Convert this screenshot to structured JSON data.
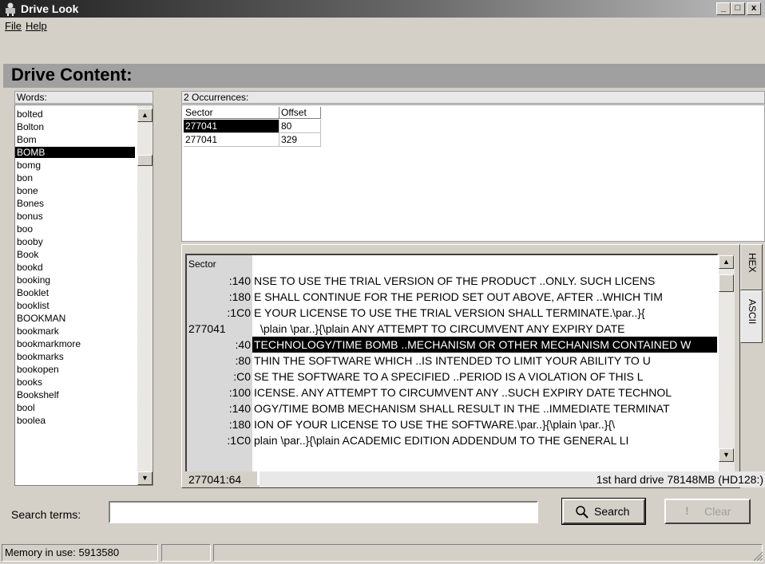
{
  "window": {
    "title": "Drive Look",
    "minimize": "_",
    "maximize": "□",
    "close": "x"
  },
  "menu": [
    {
      "label": "File"
    },
    {
      "label": "Help"
    }
  ],
  "heading": "Drive Content:",
  "words": {
    "label": "Words:",
    "items": [
      "bolted",
      "Bolton",
      "Bom",
      "BOMB",
      "bomg",
      "bon",
      "bone",
      "Bones",
      "bonus",
      "boo",
      "booby",
      "Book",
      "bookd",
      "booking",
      "Booklet",
      "booklist",
      "BOOKMAN",
      "bookmark",
      "bookmarkmore",
      "bookmarks",
      "bookopen",
      "books",
      "Bookshelf",
      "bool",
      "boolea"
    ],
    "selected": "BOMB"
  },
  "occurrences": {
    "label": "2 Occurrences:",
    "columns": [
      "Sector",
      "Offset"
    ],
    "rows": [
      [
        "277041",
        "80"
      ],
      [
        "277041",
        "329"
      ]
    ]
  },
  "viewer": {
    "header": "Sector",
    "sector": "277041",
    "lines": [
      {
        "offset": ":140",
        "text": "NSE TO USE THE TRIAL VERSION OF THE PRODUCT ..ONLY.  SUCH LICENS"
      },
      {
        "offset": ":180",
        "text": "E SHALL CONTINUE FOR THE PERIOD SET OUT ABOVE, AFTER ..WHICH TIM"
      },
      {
        "offset": ":1C0",
        "text": "E YOUR LICENSE TO USE THE TRIAL VERSION SHALL TERMINATE.\\par..}{"
      },
      {
        "offset": "",
        "text": "\\plain \\par..}{\\plain ANY ATTEMPT TO CIRCUMVENT ANY EXPIRY DATE"
      },
      {
        "offset": ":40",
        "text": "TECHNOLOGY/TIME BOMB ..MECHANISM OR OTHER MECHANISM CONTAINED W"
      },
      {
        "offset": ":80",
        "text": "THIN THE SOFTWARE WHICH ..IS INTENDED TO LIMIT YOUR ABILITY TO U"
      },
      {
        "offset": ":C0",
        "text": "SE THE SOFTWARE TO A SPECIFIED ..PERIOD IS A VIOLATION OF THIS L"
      },
      {
        "offset": ":100",
        "text": "ICENSE. ANY ATTEMPT TO CIRCUMVENT ANY ..SUCH EXPIRY DATE TECHNOL"
      },
      {
        "offset": ":140",
        "text": "OGY/TIME BOMB MECHANISM SHALL RESULT IN THE ..IMMEDIATE TERMINAT"
      },
      {
        "offset": ":180",
        "text": "ION OF YOUR LICENSE TO USE THE SOFTWARE.\\par..}{\\plain \\par..}{\\"
      },
      {
        "offset": ":1C0",
        "text": "plain \\par..}{\\plain ACADEMIC EDITION ADDENDUM TO THE GENERAL LI"
      }
    ],
    "tabs": [
      "HEX",
      "ASCII"
    ],
    "position": "277041:64",
    "drive": "1st hard drive 78148MB (HD128:)"
  },
  "search": {
    "label": "Search terms:",
    "value": "",
    "search_label": "Search",
    "clear_label": "Clear"
  },
  "status": {
    "memory": "Memory in use: 5913580"
  }
}
